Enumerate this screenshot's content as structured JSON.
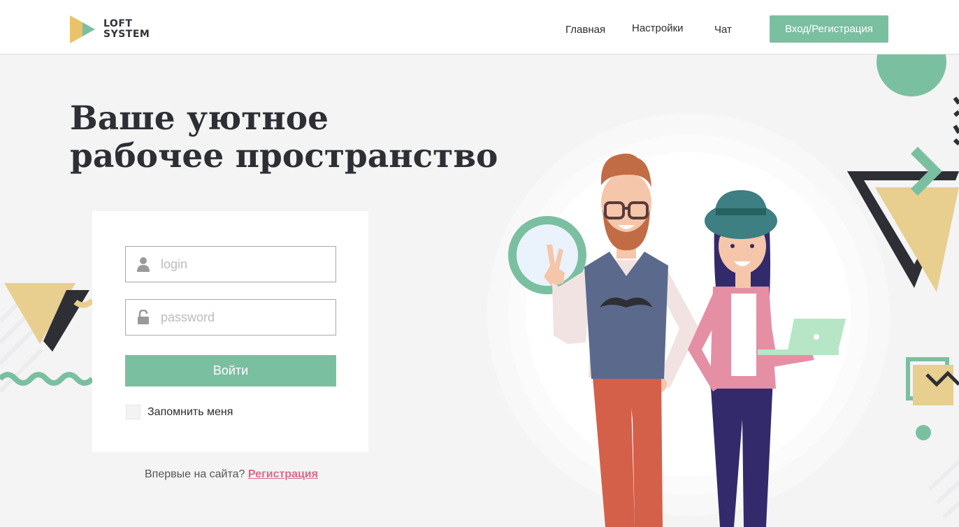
{
  "header": {
    "logo_line1": "LOFT",
    "logo_line2": "SYSTEM",
    "nav": [
      "Главная",
      "Настройки",
      "Чат"
    ],
    "auth_button": "Вход/Регистрация"
  },
  "hero": {
    "title_line1": "Ваше уютное",
    "title_line2": "рабочее пространство"
  },
  "login_form": {
    "login_placeholder": "login",
    "password_placeholder": "password",
    "submit_label": "Войти",
    "remember_label": "Запомнить меня"
  },
  "register": {
    "prompt": "Впервые на сайта?",
    "link_label": "Регистрация"
  },
  "colors": {
    "accent": "#7bbfa1",
    "pink_link": "#d8698a",
    "dark": "#2d2f34",
    "yellow": "#e8cf8f"
  },
  "icons": [
    "user-icon",
    "lock-icon",
    "logo-icon"
  ]
}
